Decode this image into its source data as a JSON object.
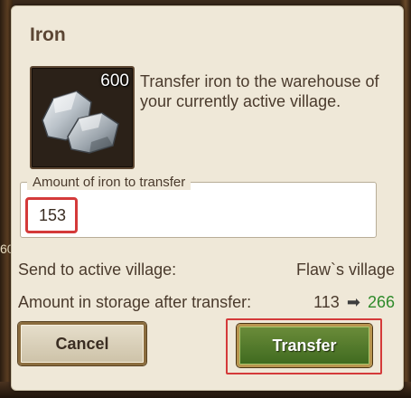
{
  "background": {
    "edge_fragment": "60"
  },
  "dialog": {
    "title": "Iron",
    "item": {
      "icon": "iron-ore-icon",
      "count": "600"
    },
    "description": "Transfer iron to the warehouse of your currently active village.",
    "amount_field": {
      "legend": "Amount of iron to transfer",
      "value": "153"
    },
    "village_row": {
      "label": "Send to active village:",
      "value": "Flaw`s village"
    },
    "storage_row": {
      "label": "Amount in storage after transfer:",
      "current": "113",
      "arrow": "➡",
      "after": "266"
    },
    "buttons": {
      "cancel": "Cancel",
      "transfer": "Transfer"
    }
  },
  "colors": {
    "panel": "#efe8d8",
    "highlight": "#d43a3a",
    "transfer_button": "#4f7a2a",
    "after_value": "#2e8a2a"
  }
}
